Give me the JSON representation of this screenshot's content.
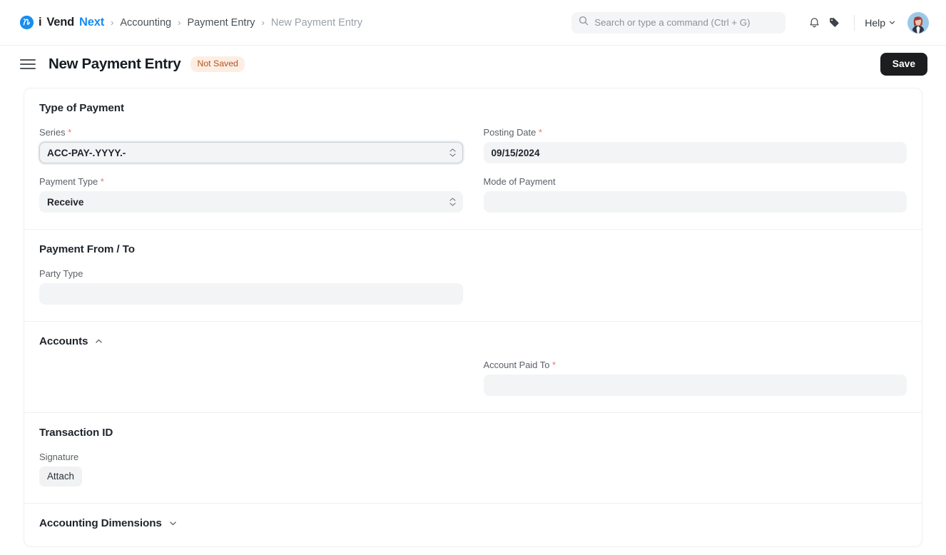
{
  "navbar": {
    "brand": {
      "i": "i",
      "vend": "Vend",
      "next": "Next",
      "logo_icon": "ivend-circle-logo"
    },
    "breadcrumbs": [
      {
        "label": "Accounting",
        "muted": false
      },
      {
        "label": "Payment Entry",
        "muted": false
      },
      {
        "label": "New Payment Entry",
        "muted": true
      }
    ],
    "separator": "›",
    "search": {
      "placeholder": "Search or type a command (Ctrl + G)",
      "icon": "search-icon"
    },
    "notifications_icon": "bell-icon",
    "tags_icon": "tag-icon",
    "help": {
      "label": "Help",
      "chevron_icon": "chevron-down-icon"
    },
    "avatar_alt": "user-avatar"
  },
  "pagehead": {
    "menu_icon": "hamburger-menu-icon",
    "title": "New Payment Entry",
    "status_badge": "Not Saved",
    "save_label": "Save"
  },
  "form": {
    "sections": [
      {
        "key": "type_of_payment",
        "title": "Type of Payment",
        "collapsible": false
      },
      {
        "key": "payment_from_to",
        "title": "Payment From / To",
        "collapsible": false
      },
      {
        "key": "accounts",
        "title": "Accounts",
        "collapsible": true,
        "chevron_icon": "chevron-up-icon"
      },
      {
        "key": "transaction_id",
        "title": "Transaction ID",
        "collapsible": false
      },
      {
        "key": "accounting_dimensions",
        "title": "Accounting Dimensions",
        "collapsible": true,
        "chevron_icon": "chevron-down-icon"
      }
    ],
    "fields": {
      "series": {
        "label": "Series",
        "required": true,
        "value": "ACC-PAY-.YYYY.-",
        "type": "select",
        "focused": true
      },
      "posting_date": {
        "label": "Posting Date",
        "required": true,
        "value": "09/15/2024",
        "type": "date"
      },
      "payment_type": {
        "label": "Payment Type",
        "required": true,
        "value": "Receive",
        "type": "select",
        "focused": false
      },
      "mode_of_payment": {
        "label": "Mode of Payment",
        "required": false,
        "value": "",
        "type": "link"
      },
      "party_type": {
        "label": "Party Type",
        "required": false,
        "value": "",
        "type": "link"
      },
      "account_paid_to": {
        "label": "Account Paid To",
        "required": true,
        "value": "",
        "type": "link"
      },
      "signature": {
        "label": "Signature",
        "required": false,
        "attach_label": "Attach"
      }
    }
  },
  "colors": {
    "brand_blue": "#1a8cf0",
    "badge_bg": "#fdeee4",
    "badge_text": "#b5521d",
    "save_bg": "#1b1d1f",
    "required_asterisk": "#e8786a",
    "control_bg": "#f3f4f5"
  }
}
